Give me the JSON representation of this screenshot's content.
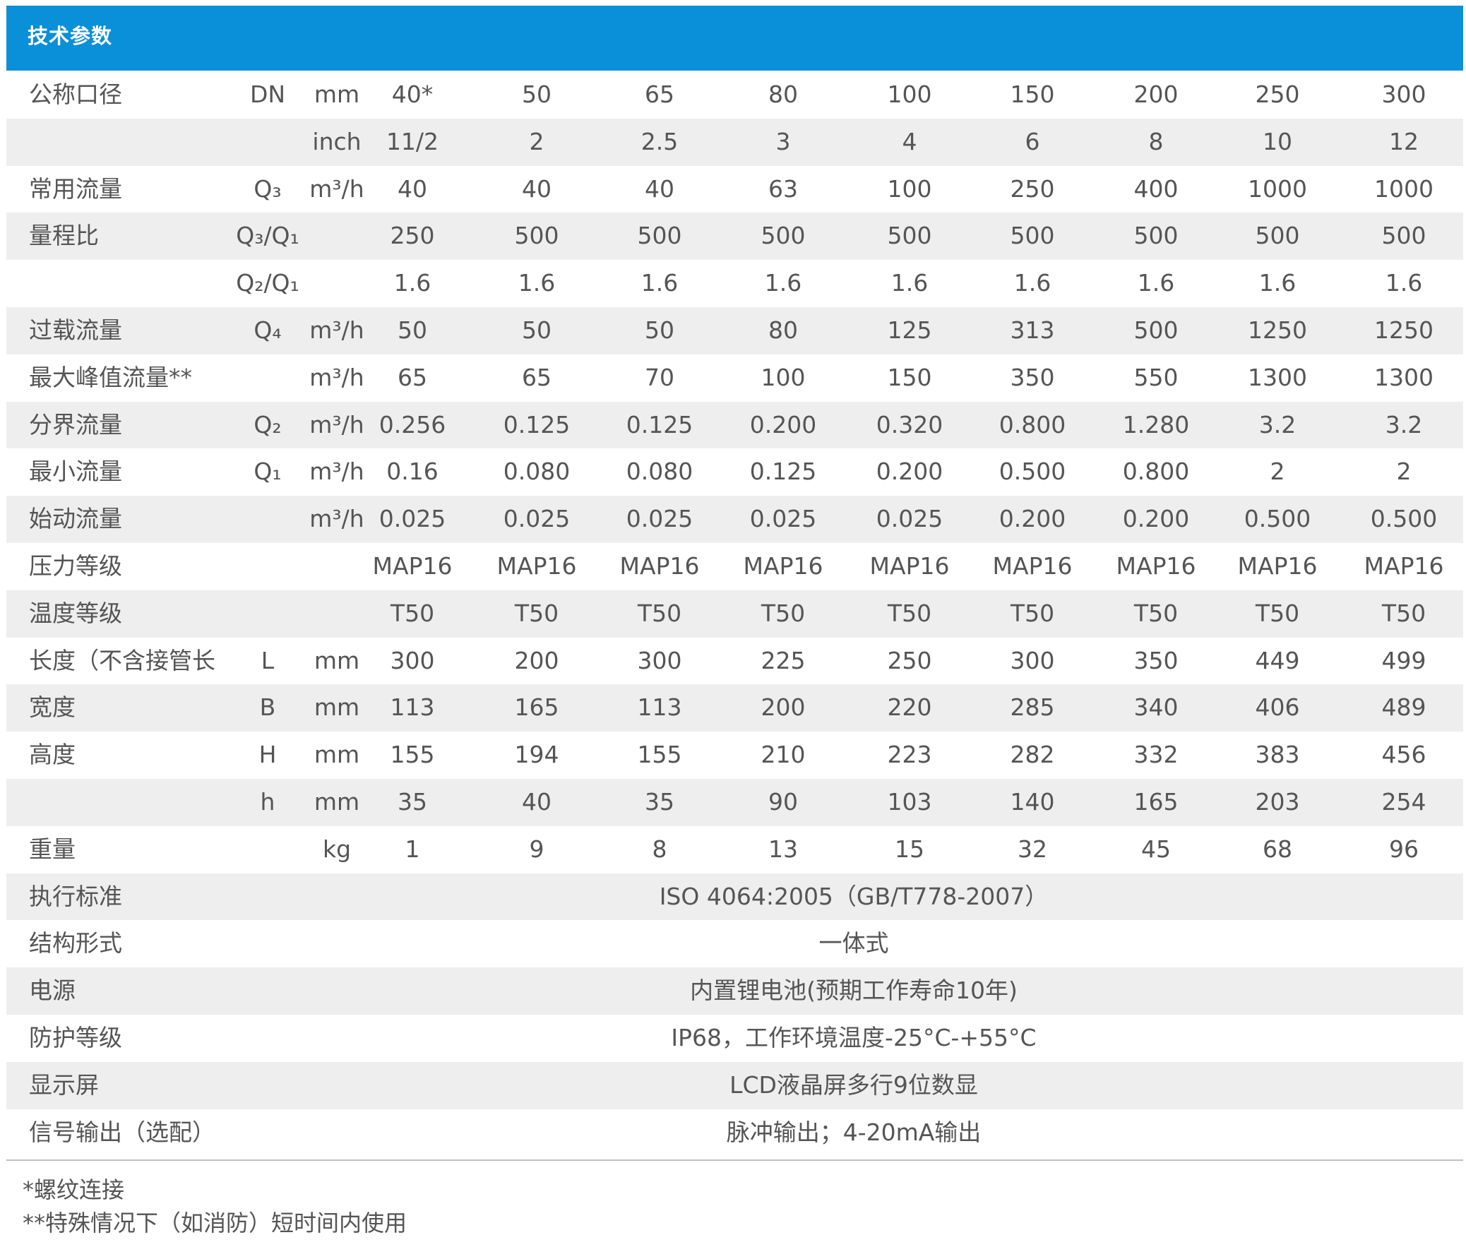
{
  "header": {
    "title": "技术参数"
  },
  "table": {
    "rows": [
      {
        "name": "公称口径",
        "symbol": "DN",
        "unit": "mm",
        "values": [
          "40*",
          "50",
          "65",
          "80",
          "100",
          "150",
          "200",
          "250",
          "300"
        ]
      },
      {
        "name": "",
        "symbol": "",
        "unit": "inch",
        "values": [
          "11/2",
          "2",
          "2.5",
          "3",
          "4",
          "6",
          "8",
          "10",
          "12"
        ]
      },
      {
        "name": "常用流量",
        "symbol": "Q₃",
        "unit": "m³/h",
        "values": [
          "40",
          "40",
          "40",
          "63",
          "100",
          "250",
          "400",
          "1000",
          "1000"
        ]
      },
      {
        "name": "量程比",
        "symbol": "Q₃/Q₁",
        "unit": "",
        "values": [
          "250",
          "500",
          "500",
          "500",
          "500",
          "500",
          "500",
          "500",
          "500"
        ]
      },
      {
        "name": "",
        "symbol": "Q₂/Q₁",
        "unit": "",
        "values": [
          "1.6",
          "1.6",
          "1.6",
          "1.6",
          "1.6",
          "1.6",
          "1.6",
          "1.6",
          "1.6"
        ]
      },
      {
        "name": "过载流量",
        "symbol": "Q₄",
        "unit": "m³/h",
        "values": [
          "50",
          "50",
          "50",
          "80",
          "125",
          "313",
          "500",
          "1250",
          "1250"
        ]
      },
      {
        "name": "最大峰值流量**",
        "symbol": "",
        "unit": "m³/h",
        "values": [
          "65",
          "65",
          "70",
          "100",
          "150",
          "350",
          "550",
          "1300",
          "1300"
        ]
      },
      {
        "name": "分界流量",
        "symbol": "Q₂",
        "unit": "m³/h",
        "values": [
          "0.256",
          "0.125",
          "0.125",
          "0.200",
          "0.320",
          "0.800",
          "1.280",
          "3.2",
          "3.2"
        ]
      },
      {
        "name": "最小流量",
        "symbol": "Q₁",
        "unit": "m³/h",
        "values": [
          "0.16",
          "0.080",
          "0.080",
          "0.125",
          "0.200",
          "0.500",
          "0.800",
          "2",
          "2"
        ]
      },
      {
        "name": "始动流量",
        "symbol": "",
        "unit": "m³/h",
        "values": [
          "0.025",
          "0.025",
          "0.025",
          "0.025",
          "0.025",
          "0.200",
          "0.200",
          "0.500",
          "0.500"
        ]
      },
      {
        "name": "压力等级",
        "symbol": "",
        "unit": "",
        "values": [
          "MAP16",
          "MAP16",
          "MAP16",
          "MAP16",
          "MAP16",
          "MAP16",
          "MAP16",
          "MAP16",
          "MAP16"
        ]
      },
      {
        "name": "温度等级",
        "symbol": "",
        "unit": "",
        "values": [
          "T50",
          "T50",
          "T50",
          "T50",
          "T50",
          "T50",
          "T50",
          "T50",
          "T50"
        ]
      },
      {
        "name": "长度（不含接管长",
        "symbol": "L",
        "unit": "mm",
        "values": [
          "300",
          "200",
          "300",
          "225",
          "250",
          "300",
          "350",
          "449",
          "499"
        ]
      },
      {
        "name": "宽度",
        "symbol": "B",
        "unit": "mm",
        "values": [
          "113",
          "165",
          "113",
          "200",
          "220",
          "285",
          "340",
          "406",
          "489"
        ]
      },
      {
        "name": "高度",
        "symbol": "H",
        "unit": "mm",
        "values": [
          "155",
          "194",
          "155",
          "210",
          "223",
          "282",
          "332",
          "383",
          "456"
        ]
      },
      {
        "name": "",
        "symbol": "h",
        "unit": "mm",
        "values": [
          "35",
          "40",
          "35",
          "90",
          "103",
          "140",
          "165",
          "203",
          "254"
        ]
      },
      {
        "name": "重量",
        "symbol": "",
        "unit": "kg",
        "values": [
          "1",
          "9",
          "8",
          "13",
          "15",
          "32",
          "45",
          "68",
          "96"
        ]
      },
      {
        "name": "执行标准",
        "span": "ISO 4064:2005（GB/T778-2007）"
      },
      {
        "name": "结构形式",
        "span": "一体式"
      },
      {
        "name": "电源",
        "span": "内置锂电池(预期工作寿命10年)"
      },
      {
        "name": "防护等级",
        "span": "IP68，工作环境温度-25°C-+55°C"
      },
      {
        "name": "显示屏",
        "span": "LCD液晶屏多行9位数显"
      },
      {
        "name": "信号输出（选配）",
        "span": "脉冲输出；4-20mA输出"
      }
    ]
  },
  "footnotes": {
    "note1": "*螺纹连接",
    "note2": "**特殊情况下（如消防）短时间内使用"
  }
}
